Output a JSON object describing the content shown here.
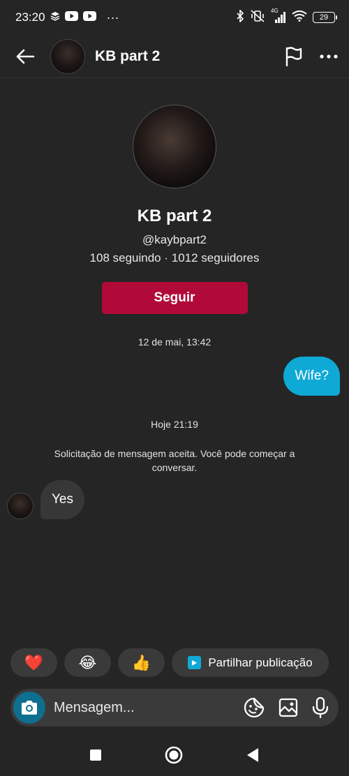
{
  "status_bar": {
    "time": "23:20",
    "more": "···",
    "network": "4G",
    "battery": "29"
  },
  "header": {
    "title": "KB part 2"
  },
  "profile": {
    "name": "KB part 2",
    "handle": "@kaybpart2",
    "stats": "108 seguindo · 1012 seguidores",
    "follow_label": "Seguir"
  },
  "conversation": {
    "timestamp_1": "12 de mai, 13:42",
    "sent_message": "Wife?",
    "timestamp_2": "Hoje 21:19",
    "system_message": "Solicitação de mensagem aceita. Você pode começar a conversar.",
    "received_message": "Yes"
  },
  "quick_replies": {
    "heart": "❤️",
    "laugh": "😂",
    "thumbs_up": "👍",
    "share_label": "Partilhar publicação"
  },
  "composer": {
    "placeholder": "Mensagem..."
  },
  "colors": {
    "background": "#252525",
    "sent_bubble": "#0fa9d6",
    "follow_button": "#b10a39",
    "received_bubble": "#373737"
  },
  "icons": [
    "back-arrow-icon",
    "flag-icon",
    "more-icon",
    "camera-icon",
    "sticker-icon",
    "gallery-icon",
    "microphone-icon",
    "share-post-icon"
  ]
}
